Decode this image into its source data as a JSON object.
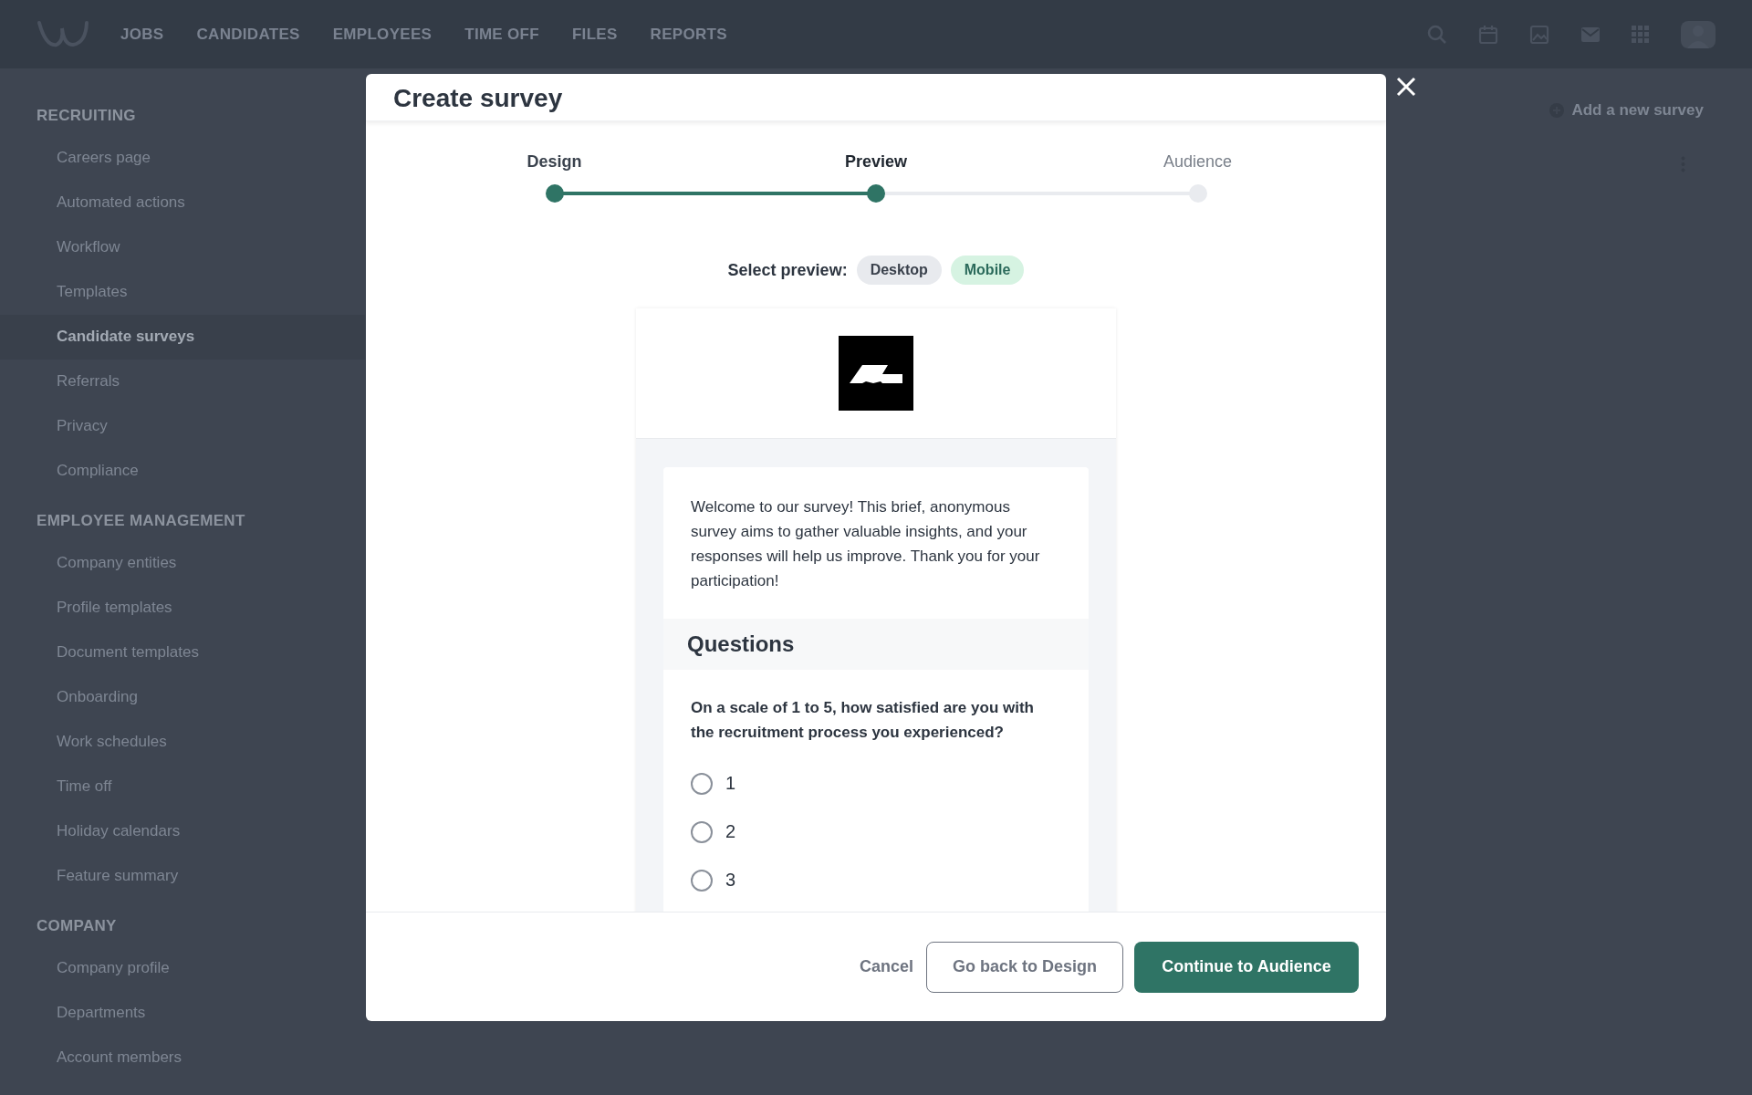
{
  "top_nav": {
    "items": [
      "JOBS",
      "CANDIDATES",
      "EMPLOYEES",
      "TIME OFF",
      "FILES",
      "REPORTS"
    ]
  },
  "sidebar": {
    "sections": [
      {
        "heading": "RECRUITING",
        "items": [
          {
            "label": "Careers page",
            "selected": false
          },
          {
            "label": "Automated actions",
            "selected": false
          },
          {
            "label": "Workflow",
            "selected": false
          },
          {
            "label": "Templates",
            "selected": false
          },
          {
            "label": "Candidate surveys",
            "selected": true
          },
          {
            "label": "Referrals",
            "selected": false
          },
          {
            "label": "Privacy",
            "selected": false
          },
          {
            "label": "Compliance",
            "selected": false
          }
        ]
      },
      {
        "heading": "EMPLOYEE MANAGEMENT",
        "items": [
          {
            "label": "Company entities",
            "selected": false
          },
          {
            "label": "Profile templates",
            "selected": false
          },
          {
            "label": "Document templates",
            "selected": false
          },
          {
            "label": "Onboarding",
            "selected": false
          },
          {
            "label": "Work schedules",
            "selected": false
          },
          {
            "label": "Time off",
            "selected": false
          },
          {
            "label": "Holiday calendars",
            "selected": false
          },
          {
            "label": "Feature summary",
            "selected": false
          }
        ]
      },
      {
        "heading": "COMPANY",
        "items": [
          {
            "label": "Company profile",
            "selected": false
          },
          {
            "label": "Departments",
            "selected": false
          },
          {
            "label": "Account members",
            "selected": false
          }
        ]
      }
    ]
  },
  "main": {
    "add_button": "Add a new survey"
  },
  "modal": {
    "title": "Create survey",
    "steps": [
      {
        "label": "Design",
        "completed": true,
        "selected": false
      },
      {
        "label": "Preview",
        "completed": false,
        "selected": true
      },
      {
        "label": "Audience",
        "completed": false,
        "selected": false
      }
    ],
    "preview_select": {
      "label": "Select preview:",
      "options": [
        {
          "label": "Desktop",
          "selected": false
        },
        {
          "label": "Mobile",
          "selected": true
        }
      ]
    },
    "survey_preview": {
      "intro": "Welcome to our survey! This brief, anonymous survey aims to gather valuable insights, and your responses will help us improve. Thank you for your participation!",
      "section_title": "Questions",
      "question": "On a scale of 1 to 5, how satisfied are you with the recruitment process you experienced?",
      "options": [
        {
          "label": "1",
          "checked": false
        },
        {
          "label": "2",
          "checked": false
        },
        {
          "label": "3",
          "checked": false
        }
      ]
    },
    "buttons": {
      "cancel": "Cancel",
      "back": "Go back to Design",
      "continue": "Continue to Audience"
    }
  }
}
